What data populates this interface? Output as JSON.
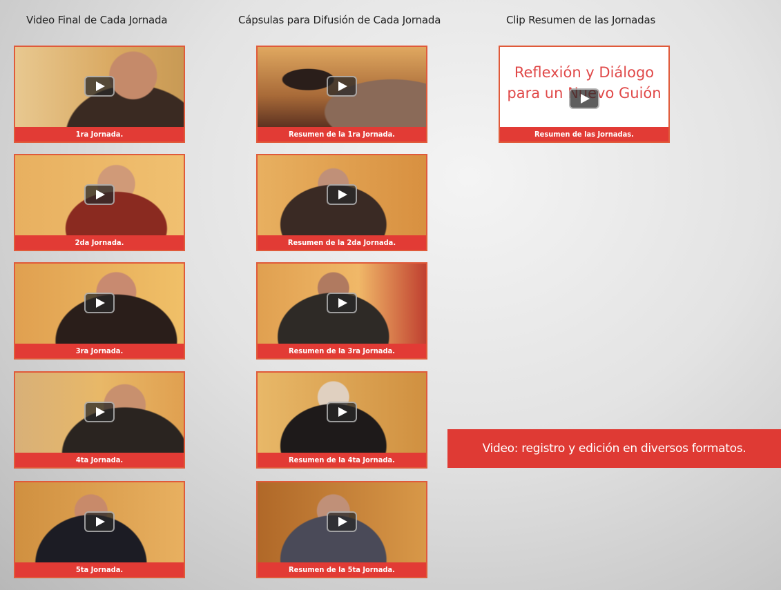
{
  "columns": {
    "final": {
      "title": "Video Final de Cada Jornada"
    },
    "capsulas": {
      "title": "Cápsulas para Difusión de Cada Jornada"
    },
    "clip": {
      "title": "Clip Resumen de las Jornadas"
    }
  },
  "final_videos": [
    {
      "caption": "1ra Jornada."
    },
    {
      "caption": "2da Jornada."
    },
    {
      "caption": "3ra Jornada."
    },
    {
      "caption": "4ta Jornada."
    },
    {
      "caption": "5ta Jornada."
    }
  ],
  "capsule_videos": [
    {
      "caption": "Resumen de la 1ra Jornada."
    },
    {
      "caption": "Resumen de la 2da Jornada."
    },
    {
      "caption": "Resumen de la 3ra Jornada."
    },
    {
      "caption": "Resumen de la 4ta Jornada."
    },
    {
      "caption": "Resumen de la 5ta Jornada."
    }
  ],
  "clip_video": {
    "caption": "Resumen de las Jornadas.",
    "title_line1": "Reflexión y Diálogo",
    "title_line2": "para un Nuevo Guión"
  },
  "banner": {
    "text": "Video: registro y edición en diversos formatos."
  },
  "icons": {
    "play": "play-button-icon"
  },
  "colors": {
    "accent": "#e23b35",
    "clip_text": "#e04848"
  }
}
